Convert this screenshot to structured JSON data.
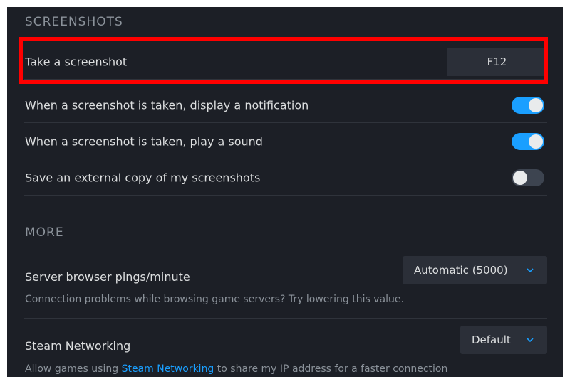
{
  "screenshots": {
    "header": "SCREENSHOTS",
    "take_label": "Take a screenshot",
    "take_key": "F12",
    "notify_label": "When a screenshot is taken, display a notification",
    "notify_on": true,
    "sound_label": "When a screenshot is taken, play a sound",
    "sound_on": true,
    "external_label": "Save an external copy of my screenshots",
    "external_on": false
  },
  "more": {
    "header": "MORE",
    "pings_label": "Server browser pings/minute",
    "pings_value": "Automatic (5000)",
    "pings_desc": "Connection problems while browsing game servers? Try lowering this value.",
    "networking_label": "Steam Networking",
    "networking_value": "Default",
    "networking_desc_pre": "Allow games using",
    "networking_desc_link": "Steam Networking",
    "networking_desc_post": "to share my IP address for a faster connection"
  },
  "colors": {
    "accent": "#1a9fff",
    "highlight": "#ff0000",
    "background": "#1c1f26"
  },
  "icons": {
    "dropdown": "chevron-down-icon"
  }
}
